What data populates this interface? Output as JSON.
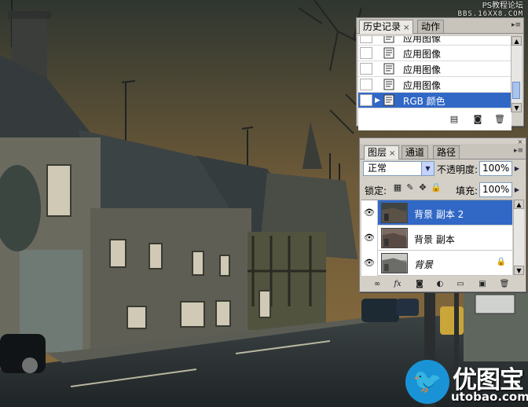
{
  "watermark": {
    "line1": "PS教程论坛",
    "line2": "BBS.16XX8.COM"
  },
  "history_panel": {
    "tabs": [
      {
        "label": "历史记录",
        "close": "×"
      },
      {
        "label": "动作"
      }
    ],
    "menu_icon": "flyout-menu-icon",
    "items": [
      {
        "label": "应用图像",
        "selected": false
      },
      {
        "label": "应用图像",
        "selected": false
      },
      {
        "label": "应用图像",
        "selected": false
      },
      {
        "label": "应用图像",
        "selected": false
      },
      {
        "label": "RGB 颜色",
        "selected": true
      }
    ],
    "footer_icons": [
      "new-document-from-state-icon",
      "camera-snapshot-icon",
      "trash-icon"
    ]
  },
  "layers_panel": {
    "tabs": [
      {
        "label": "图层",
        "close": "×"
      },
      {
        "label": "通道"
      },
      {
        "label": "路径"
      }
    ],
    "blend_mode": "正常",
    "opacity_label": "不透明度:",
    "opacity_value": "100%",
    "lock_label": "锁定:",
    "fill_label": "填充:",
    "fill_value": "100%",
    "layers": [
      {
        "name": "背景 副本 2",
        "visible": true,
        "selected": true,
        "locked": false,
        "italic": false
      },
      {
        "name": "背景 副本",
        "visible": true,
        "selected": false,
        "locked": false,
        "italic": false
      },
      {
        "name": "背景",
        "visible": true,
        "selected": false,
        "locked": true,
        "italic": true
      }
    ],
    "footer_icons": [
      "link-icon",
      "fx-icon",
      "mask-icon",
      "adjustment-icon",
      "folder-icon",
      "new-layer-icon",
      "trash-icon"
    ]
  },
  "logo": {
    "brand_cn": "优图宝",
    "brand_en": "utobao.com"
  },
  "colors": {
    "selection": "#3168c6",
    "panel": "#d4d0c8",
    "sky": "#8a6a3a",
    "brand": "#1a93d6"
  }
}
